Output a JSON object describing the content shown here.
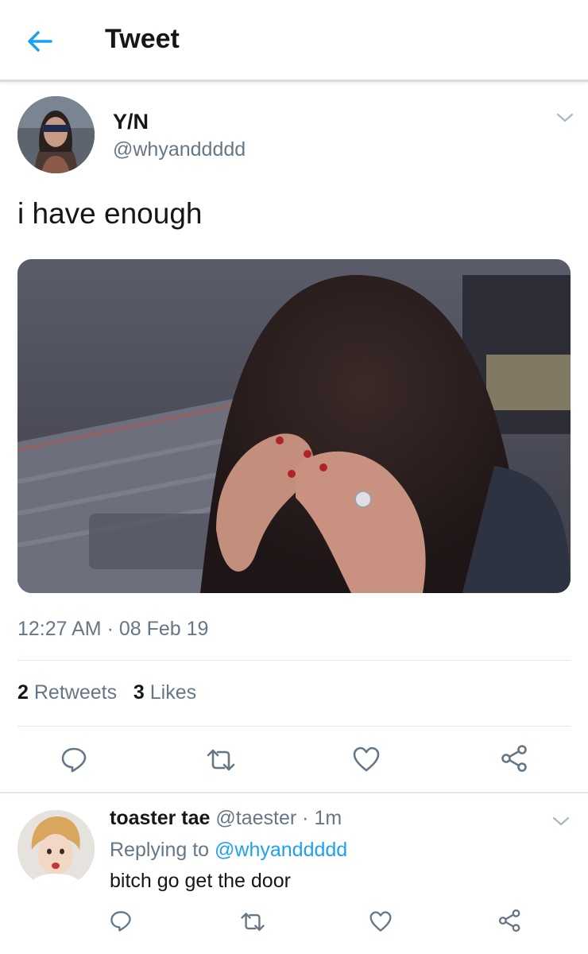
{
  "header": {
    "back_icon": "arrow-left-icon",
    "title": "Tweet",
    "accent": "#1da1f2"
  },
  "tweet": {
    "display_name": "Y/N",
    "handle": "@whyanddddd",
    "text": "i have enough",
    "timestamp": "12:27 AM · 08 Feb 19",
    "retweets_count": "2",
    "retweets_label": "Retweets",
    "likes_count": "3",
    "likes_label": "Likes",
    "actions": [
      "reply-icon",
      "retweet-icon",
      "like-icon",
      "share-icon"
    ]
  },
  "reply": {
    "display_name": "toaster tae",
    "handle": "@taester",
    "separator": "·",
    "age": "1m",
    "replying_to_prefix": "Replying to",
    "replying_to_handle": "@whyanddddd",
    "text": "bitch go get the door",
    "actions": [
      "reply-icon",
      "retweet-icon",
      "like-icon",
      "share-icon"
    ]
  },
  "colors": {
    "text_primary": "#14171a",
    "text_secondary": "#657786",
    "divider": "#e1e8ed",
    "link": "#1da1f2"
  }
}
